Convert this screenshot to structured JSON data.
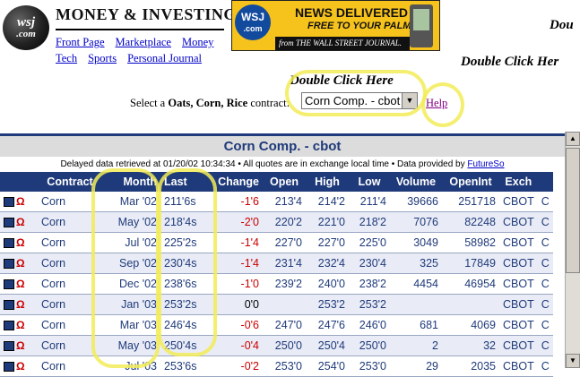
{
  "logo": {
    "top": "wsj",
    "bottom": ".com"
  },
  "brand": "MONEY & INVESTING",
  "nav_row1": [
    "Front Page",
    "Marketplace",
    "Money"
  ],
  "nav_row2": [
    "Tech",
    "Sports",
    "Personal Journal"
  ],
  "ad": {
    "logo_top": "WSJ",
    "logo_bottom": ".com",
    "line1": "NEWS DELIVERED",
    "line2": "FREE TO YOUR PALM!",
    "bar": "from THE WALL STREET JOURNAL."
  },
  "double_click_main": "Double Click Here",
  "double_click_right1": "Dou",
  "double_click_right2": "Double Click Her",
  "select": {
    "label_prefix": "Select a ",
    "label_bold": "Oats, Corn, Rice",
    "label_suffix": " contract:",
    "value": "Corn Comp. - cbot",
    "help": "Help"
  },
  "table_title": "Corn Comp. - cbot",
  "delayed_note": "Delayed data retrieved at 01/20/02 10:34:34 • All quotes are in exchange local time • Data provided by ",
  "delayed_link": "FutureSo",
  "columns": [
    "",
    "Contract",
    "Month",
    "Last",
    "Change",
    "Open",
    "High",
    "Low",
    "Volume",
    "OpenInt",
    "Exch",
    ""
  ],
  "rows": [
    {
      "contract": "Corn",
      "month": "Mar '02",
      "last": "211'6s",
      "change": "-1'6",
      "open": "213'4",
      "high": "214'2",
      "low": "211'4",
      "volume": "39666",
      "openint": "251718",
      "exch": "CBOT",
      "extra": "C"
    },
    {
      "contract": "Corn",
      "month": "May '02",
      "last": "218'4s",
      "change": "-2'0",
      "open": "220'2",
      "high": "221'0",
      "low": "218'2",
      "volume": "7076",
      "openint": "82248",
      "exch": "CBOT",
      "extra": "C"
    },
    {
      "contract": "Corn",
      "month": "Jul '02",
      "last": "225'2s",
      "change": "-1'4",
      "open": "227'0",
      "high": "227'0",
      "low": "225'0",
      "volume": "3049",
      "openint": "58982",
      "exch": "CBOT",
      "extra": "C"
    },
    {
      "contract": "Corn",
      "month": "Sep '02",
      "last": "230'4s",
      "change": "-1'4",
      "open": "231'4",
      "high": "232'4",
      "low": "230'4",
      "volume": "325",
      "openint": "17849",
      "exch": "CBOT",
      "extra": "C"
    },
    {
      "contract": "Corn",
      "month": "Dec '02",
      "last": "238'6s",
      "change": "-1'0",
      "open": "239'2",
      "high": "240'0",
      "low": "238'2",
      "volume": "4454",
      "openint": "46954",
      "exch": "CBOT",
      "extra": "C"
    },
    {
      "contract": "Corn",
      "month": "Jan '03",
      "last": "253'2s",
      "change": "0'0",
      "open": "",
      "high": "253'2",
      "low": "253'2",
      "volume": "",
      "openint": "",
      "exch": "CBOT",
      "extra": "C"
    },
    {
      "contract": "Corn",
      "month": "Mar '03",
      "last": "246'4s",
      "change": "-0'6",
      "open": "247'0",
      "high": "247'6",
      "low": "246'0",
      "volume": "681",
      "openint": "4069",
      "exch": "CBOT",
      "extra": "C"
    },
    {
      "contract": "Corn",
      "month": "May '03",
      "last": "250'4s",
      "change": "-0'4",
      "open": "250'0",
      "high": "250'4",
      "low": "250'0",
      "volume": "2",
      "openint": "32",
      "exch": "CBOT",
      "extra": "C"
    },
    {
      "contract": "Corn",
      "month": "Jul '03",
      "last": "253'6s",
      "change": "-0'2",
      "open": "253'0",
      "high": "254'0",
      "low": "253'0",
      "volume": "29",
      "openint": "2035",
      "exch": "CBOT",
      "extra": "C"
    }
  ],
  "colors": {
    "header_blue": "#1f3a7a",
    "negative": "#cc0000",
    "ad_yellow": "#f6c21c",
    "highlight": "#f2ec58"
  }
}
